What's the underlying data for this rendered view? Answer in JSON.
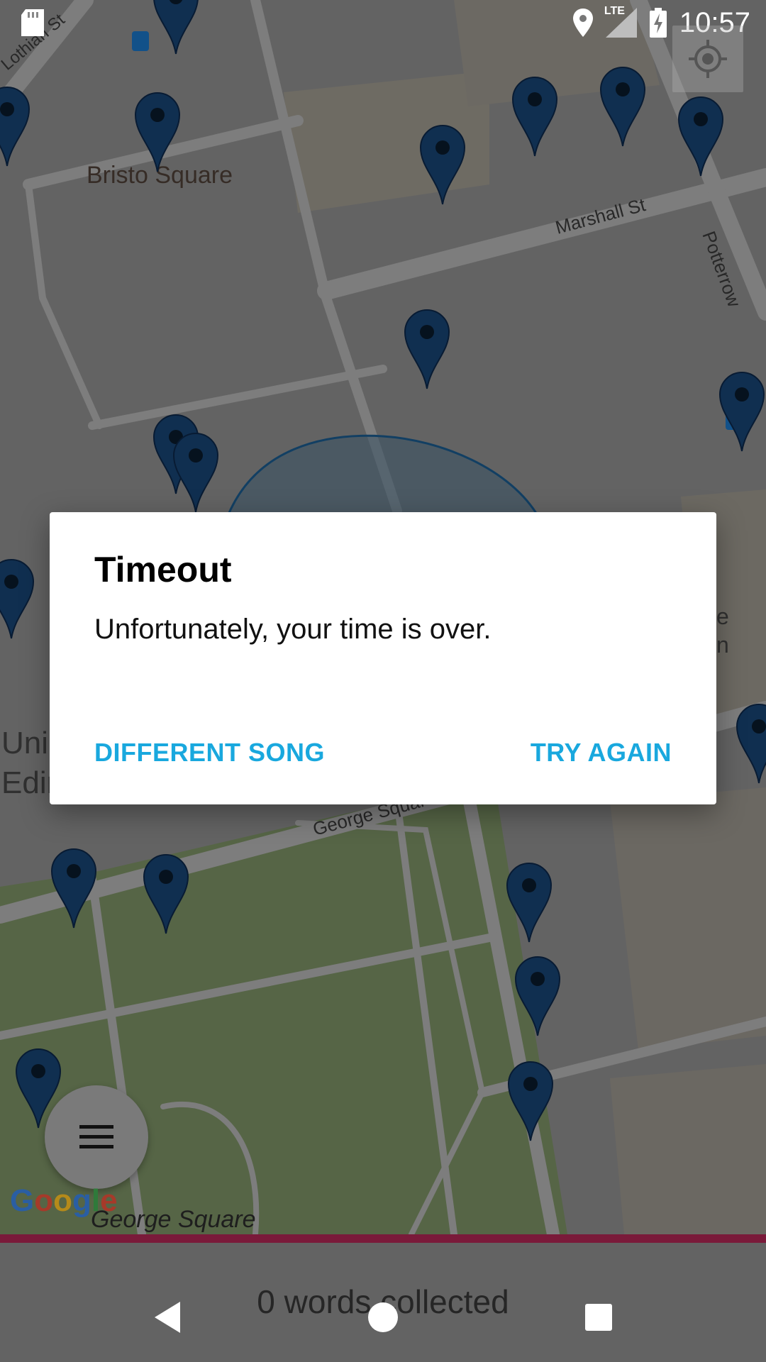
{
  "status_bar": {
    "time": "10:57",
    "network": "LTE",
    "icons": [
      "sd-card-icon",
      "location-icon",
      "lte-signal-icon",
      "battery-charging-icon"
    ]
  },
  "map": {
    "labels": {
      "lothian": "Lothian St",
      "bristo": "Bristo Square",
      "marshall": "Marshall St",
      "potterrow": "Potterrow",
      "george_sq_road": "George Squar",
      "george_square": "George Square",
      "uni_line1": "Uni",
      "uni_line2": "Edin",
      "edge_e": "e",
      "edge_n": "n"
    },
    "google_logo": "Google",
    "colors": {
      "pin": "#1c4f86",
      "park": "#8fa876",
      "road": "#d6d6d6"
    }
  },
  "dialog": {
    "title": "Timeout",
    "message": "Unfortunately, your time is over.",
    "buttons": {
      "different_song": "DIFFERENT SONG",
      "try_again": "TRY AGAIN"
    },
    "accent_color": "#19a8de"
  },
  "fab": {
    "icon": "menu-icon"
  },
  "bottom": {
    "words_collected": "0 words collected"
  },
  "nav": {
    "icons": [
      "back-icon",
      "home-icon",
      "recents-icon"
    ]
  }
}
